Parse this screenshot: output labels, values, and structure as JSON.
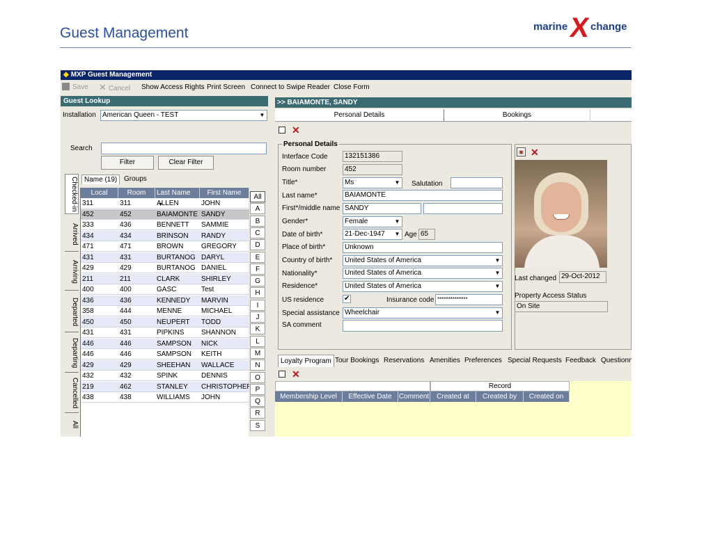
{
  "slide": {
    "title": "Guest Management"
  },
  "logo": {
    "left": "marine",
    "x": "X",
    "right": "change"
  },
  "window": {
    "title": "MXP Guest Management"
  },
  "toolbar": {
    "save": "Save",
    "cancel": "Cancel",
    "show_access_rights": "Show Access Rights",
    "print_screen": "Print Screen",
    "connect_swipe": "Connect to Swipe Reader",
    "close_form": "Close Form"
  },
  "lookup": {
    "title": "Guest Lookup",
    "installation_label": "Installation",
    "installation_value": "American Queen - TEST",
    "search_label": "Search",
    "search_value": "",
    "filter": "Filter",
    "clear_filter": "Clear Filter",
    "vertical_tabs": [
      "Checked-in",
      "Arrived",
      "Arriving",
      "Departed",
      "Departing",
      "Cancelled",
      "All"
    ],
    "grid_tabs": [
      "Name (19)",
      "Groups"
    ],
    "columns": [
      "Local",
      "Room",
      "Last Name",
      "First Name"
    ],
    "rows": [
      [
        "311",
        "311",
        "ALLEN",
        "JOHN"
      ],
      [
        "452",
        "452",
        "BAIAMONTE",
        "SANDY"
      ],
      [
        "333",
        "436",
        "BENNETT",
        "SAMMIE"
      ],
      [
        "434",
        "434",
        "BRINSON",
        "RANDY"
      ],
      [
        "471",
        "471",
        "BROWN",
        "GREGORY"
      ],
      [
        "431",
        "431",
        "BURTANOG",
        "DARYL"
      ],
      [
        "429",
        "429",
        "BURTANOG",
        "DANIEL"
      ],
      [
        "211",
        "211",
        "CLARK",
        "SHIRLEY"
      ],
      [
        "400",
        "400",
        "GASC",
        "Test"
      ],
      [
        "436",
        "436",
        "KENNEDY",
        "MARVIN"
      ],
      [
        "358",
        "444",
        "MENNE",
        "MICHAEL"
      ],
      [
        "450",
        "450",
        "NEUPERT",
        "TODD"
      ],
      [
        "431",
        "431",
        "PIPKINS",
        "SHANNON"
      ],
      [
        "446",
        "446",
        "SAMPSON",
        "NICK"
      ],
      [
        "446",
        "446",
        "SAMPSON",
        "KEITH"
      ],
      [
        "429",
        "429",
        "SHEEHAN",
        "WALLACE"
      ],
      [
        "432",
        "432",
        "SPINK",
        "DENNIS"
      ],
      [
        "219",
        "462",
        "STANLEY",
        "CHRISTOPHER"
      ],
      [
        "438",
        "438",
        "WILLIAMS",
        "JOHN"
      ]
    ],
    "selected_row": 1,
    "alphabet": [
      "All",
      "A",
      "B",
      "C",
      "D",
      "E",
      "F",
      "G",
      "H",
      "I",
      "J",
      "K",
      "L",
      "M",
      "N",
      "O",
      "P",
      "Q",
      "R",
      "S"
    ]
  },
  "detail": {
    "header": ">> BAIAMONTE, SANDY",
    "tabs": [
      "Personal Details",
      "Bookings"
    ],
    "section_title": "Personal Details",
    "fields": {
      "interface_code_label": "Interface Code",
      "interface_code": "132151386",
      "room_number_label": "Room number",
      "room_number": "452",
      "title_label": "Title*",
      "title": "Ms",
      "salutation_label": "Salutation",
      "salutation": "",
      "last_name_label": "Last name*",
      "last_name": "BAIAMONTE",
      "first_name_label": "First*/middle name",
      "first_name": "SANDY",
      "middle_name": "",
      "gender_label": "Gender*",
      "gender": "Female",
      "dob_label": "Date of birth*",
      "dob": "21-Dec-1947",
      "age_label": "Age",
      "age": "65",
      "pob_label": "Place of birth*",
      "pob": "Unknown",
      "cob_label": "Country of birth*",
      "cob": "United States of America",
      "nationality_label": "Nationality*",
      "nationality": "United States of America",
      "residence_label": "Residence*",
      "residence": "United States of America",
      "us_residence_label": "US residence",
      "us_residence_check": "✔",
      "insurance_label": "Insurance code",
      "insurance": "**************",
      "special_assistance_label": "Special assistance",
      "special_assistance": "Wheelchair",
      "sa_comment_label": "SA comment",
      "sa_comment": ""
    },
    "photo": {
      "last_changed_label": "Last changed",
      "last_changed": "29-Oct-2012",
      "access_status_label": "Property Access Status",
      "access_status": "On Site"
    },
    "bottom_tabs": [
      "Loyalty Program",
      "Tour Bookings",
      "Reservations",
      "Amenities",
      "Preferences",
      "Special Requests",
      "Feedback",
      "Questionn"
    ],
    "loyalty": {
      "record_header": "Record",
      "columns": [
        "Membership Level",
        "Effective Date",
        "Comment",
        "Created at",
        "Created by",
        "Created on"
      ]
    }
  }
}
